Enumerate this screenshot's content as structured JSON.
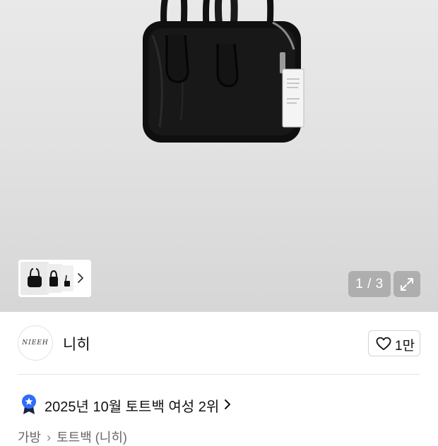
{
  "gallery": {
    "counter": "1 / 3",
    "thumbnails": [
      "bag-front-thumbnail",
      "bag-side-thumbnail",
      "bag-small-thumbnail"
    ]
  },
  "brand": {
    "logo_text": "NIEEH",
    "name": "니히",
    "like_count": "1만"
  },
  "ranking": {
    "text": "2025년 10월 토트백 여성 2위"
  },
  "breadcrumb": {
    "items": [
      "가방",
      "토트백 (니히)"
    ]
  },
  "icons": {
    "expand": "expand-icon",
    "heart": "heart-icon",
    "badge": "ranking-badge-icon",
    "chevron": "chevron-right-icon"
  },
  "colors": {
    "badge_blue": "#2f6bff",
    "badge_dark": "#1a2340"
  }
}
